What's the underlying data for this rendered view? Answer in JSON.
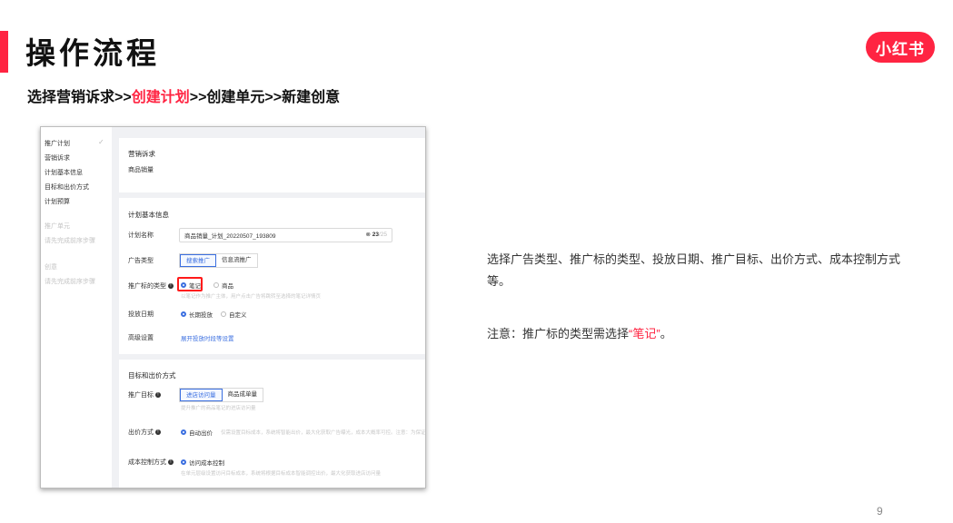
{
  "slide": {
    "title": "操作流程",
    "logo_text": "小红书",
    "subtitle_part1": "选择营销诉求>>",
    "subtitle_highlight": "创建计划",
    "subtitle_part2": ">>创建单元>>新建创意",
    "description": "选择广告类型、推广标的类型、投放日期、推广目标、出价方式、成本控制方式等。",
    "note_prefix": "注意：推广标的类型需选择",
    "note_highlight": "“笔记”",
    "note_suffix": "。",
    "page_number": "9",
    "accent_color": "#ff2442"
  },
  "screenshot": {
    "nav": {
      "plan": "推广计划",
      "plan_items": [
        "营销诉求",
        "计划基本信息",
        "目标和出价方式",
        "计划预算"
      ],
      "unit": "推广单元",
      "unit_hint": "请先完成前序步骤",
      "creative": "创意",
      "creative_hint": "请先完成前序步骤"
    },
    "marketing": {
      "title": "营销诉求",
      "value": "商品销量"
    },
    "basic": {
      "title": "计划基本信息",
      "name_label": "计划名称",
      "name_value": "商品销量_计划_20220507_193809",
      "name_count": "23",
      "name_max": "/25",
      "ad_type_label": "广告类型",
      "ad_type_options": [
        "搜索推广",
        "信息流推广"
      ],
      "target_type_label": "推广标的类型",
      "target_type_options": [
        "笔记",
        "商品"
      ],
      "target_type_hint": "以笔记作为推广主体，用户点击广告将跳转至选择的笔记详情页",
      "date_label": "投放日期",
      "date_options": [
        "长期投放",
        "自定义"
      ],
      "advanced_label": "高级设置",
      "advanced_link": "展开投放时段等设置"
    },
    "goal": {
      "title": "目标和出价方式",
      "target_label": "推广目标",
      "target_options": [
        "进店访问量",
        "商品成单量"
      ],
      "target_hint": "提升推广的商品笔记的进店访问量",
      "bid_label": "出价方式",
      "bid_option": "自动出价",
      "bid_hint": "仅需设置目标成本，系统将智能出价，最大化获取广告曝光，成本大概率可控。注意：为保证转化效果",
      "cost_label": "成本控制方式",
      "cost_option": "访问成本控制",
      "cost_hint": "在单元层级设置访问目标成本，系统将根据目标成本智能调控出价，最大化获取进店访问量"
    }
  }
}
